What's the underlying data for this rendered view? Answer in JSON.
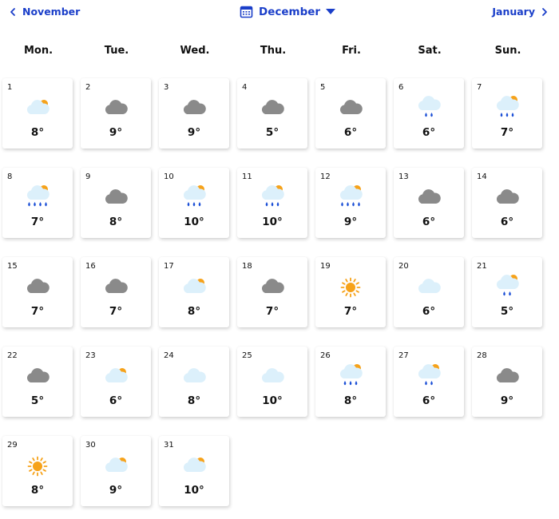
{
  "nav": {
    "prev_label": "November",
    "next_label": "January",
    "current_month": "December"
  },
  "weekdays": [
    "Mon.",
    "Tue.",
    "Wed.",
    "Thu.",
    "Fri.",
    "Sat.",
    "Sun."
  ],
  "days": [
    {
      "day": "1",
      "icon": "partly-cloudy-icon",
      "temp": "8°"
    },
    {
      "day": "2",
      "icon": "cloud-icon",
      "temp": "9°"
    },
    {
      "day": "3",
      "icon": "cloud-icon",
      "temp": "9°"
    },
    {
      "day": "4",
      "icon": "cloud-icon",
      "temp": "5°"
    },
    {
      "day": "5",
      "icon": "cloud-icon",
      "temp": "6°"
    },
    {
      "day": "6",
      "icon": "light-rain-icon",
      "temp": "6°"
    },
    {
      "day": "7",
      "icon": "partly-cloudy-rain-icon",
      "temp": "7°"
    },
    {
      "day": "8",
      "icon": "partly-cloudy-heavy-rain-icon",
      "temp": "7°"
    },
    {
      "day": "9",
      "icon": "cloud-icon",
      "temp": "8°"
    },
    {
      "day": "10",
      "icon": "partly-cloudy-rain-icon",
      "temp": "10°"
    },
    {
      "day": "11",
      "icon": "partly-cloudy-rain-icon",
      "temp": "10°"
    },
    {
      "day": "12",
      "icon": "partly-cloudy-heavy-rain-icon",
      "temp": "9°"
    },
    {
      "day": "13",
      "icon": "cloud-icon",
      "temp": "6°"
    },
    {
      "day": "14",
      "icon": "cloud-icon",
      "temp": "6°"
    },
    {
      "day": "15",
      "icon": "cloud-icon",
      "temp": "7°"
    },
    {
      "day": "16",
      "icon": "cloud-icon",
      "temp": "7°"
    },
    {
      "day": "17",
      "icon": "partly-cloudy-icon",
      "temp": "8°"
    },
    {
      "day": "18",
      "icon": "cloud-icon",
      "temp": "7°"
    },
    {
      "day": "19",
      "icon": "sun-icon",
      "temp": "7°"
    },
    {
      "day": "20",
      "icon": "light-cloud-icon",
      "temp": "6°"
    },
    {
      "day": "21",
      "icon": "partly-cloudy-light-rain-icon",
      "temp": "5°"
    },
    {
      "day": "22",
      "icon": "cloud-icon",
      "temp": "5°"
    },
    {
      "day": "23",
      "icon": "partly-cloudy-icon",
      "temp": "6°"
    },
    {
      "day": "24",
      "icon": "light-cloud-icon",
      "temp": "8°"
    },
    {
      "day": "25",
      "icon": "light-cloud-icon",
      "temp": "10°"
    },
    {
      "day": "26",
      "icon": "partly-cloudy-rain-icon",
      "temp": "8°"
    },
    {
      "day": "27",
      "icon": "partly-cloudy-light-rain-icon",
      "temp": "6°"
    },
    {
      "day": "28",
      "icon": "cloud-icon",
      "temp": "9°"
    },
    {
      "day": "29",
      "icon": "sun-icon",
      "temp": "8°"
    },
    {
      "day": "30",
      "icon": "partly-cloudy-icon",
      "temp": "9°"
    },
    {
      "day": "31",
      "icon": "partly-cloudy-icon",
      "temp": "10°"
    }
  ],
  "colors": {
    "accent": "#1a3ec9",
    "cloud_grey": "#8a8a8a",
    "cloud_light": "#dcf0fb",
    "sun": "#f6a21a",
    "rain": "#1b4fd6"
  }
}
